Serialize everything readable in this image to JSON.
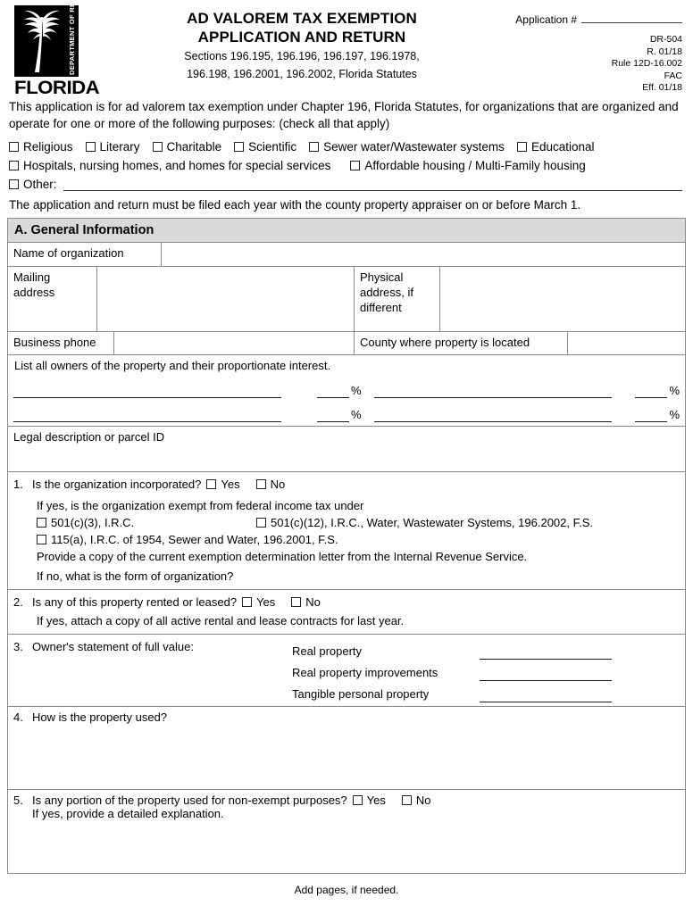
{
  "header": {
    "logo": {
      "vertical_text": "DEPARTMENT OF REVENUE",
      "wordmark": "FLORIDA"
    },
    "title_line1": "AD VALOREM TAX EXEMPTION",
    "title_line2": "APPLICATION AND RETURN",
    "subtitle_line1": "Sections 196.195, 196.196, 196.197, 196.1978,",
    "subtitle_line2": "196.198, 196.2001, 196.2002, Florida Statutes",
    "application_number_label": "Application #",
    "application_number_value": "",
    "form_number": "DR-504",
    "revision": "R. 01/18",
    "rule": "Rule 12D-16.002",
    "fac": "FAC",
    "effective": "Eff. 01/18"
  },
  "intro": {
    "paragraph": "This application is for ad valorem tax exemption under Chapter 196, Florida Statutes, for organizations that are organized and operate for one or more of the following purposes: (check all that apply)",
    "filing_note": "The application and return must be filed each year with the county property appraiser on or before March 1."
  },
  "purposes": {
    "row1": [
      {
        "label": "Religious",
        "checked": false
      },
      {
        "label": "Literary",
        "checked": false
      },
      {
        "label": "Charitable",
        "checked": false
      },
      {
        "label": "Scientific",
        "checked": false
      },
      {
        "label": "Sewer water/Wastewater systems",
        "checked": false
      },
      {
        "label": "Educational",
        "checked": false
      }
    ],
    "row2": [
      {
        "label": "Hospitals, nursing homes, and homes for special services",
        "checked": false
      },
      {
        "label": "Affordable housing / Multi-Family housing",
        "checked": false
      }
    ],
    "row3": {
      "label": "Other:",
      "checked": false,
      "value": ""
    }
  },
  "section_a": {
    "heading": "A. General Information",
    "name_of_organization": {
      "label": "Name of organization",
      "value": ""
    },
    "mailing_address": {
      "label": "Mailing address",
      "value": ""
    },
    "physical_address": {
      "label": "Physical address, if different",
      "value": ""
    },
    "business_phone": {
      "label": "Business phone",
      "value": ""
    },
    "county": {
      "label": "County where property is located",
      "value": ""
    },
    "owners": {
      "instruction": "List all owners of the property and their proportionate interest.",
      "percent_symbol": "%",
      "rows": [
        {
          "owner_left": "",
          "pct_left": "",
          "owner_right": "",
          "pct_right": ""
        },
        {
          "owner_left": "",
          "pct_left": "",
          "owner_right": "",
          "pct_right": ""
        }
      ]
    },
    "legal_description": {
      "label": "Legal description or parcel ID",
      "value": ""
    }
  },
  "questions": {
    "q1": {
      "number": "1.",
      "text": "Is the organization incorporated?",
      "yes_label": "Yes",
      "no_label": "No",
      "sub_intro": "If yes, is the organization exempt from federal income tax under",
      "opt1": "501(c)(3), I.R.C.",
      "opt2": "501(c)(12), I.R.C., Water, Wastewater Systems, 196.2002, F.S.",
      "opt3": "115(a), I.R.C. of 1954, Sewer and Water, 196.2001, F.S.",
      "provide_note": "Provide a copy of the current exemption determination letter from the Internal Revenue Service.",
      "if_no": "If no, what is the form of organization?"
    },
    "q2": {
      "number": "2.",
      "text": "Is any of this property rented or leased?",
      "yes_label": "Yes",
      "no_label": "No",
      "note": "If yes, attach a copy of all active rental and lease contracts for last year."
    },
    "q3": {
      "number": "3.",
      "text": "Owner's statement of full value:",
      "items": [
        {
          "label": "Real property",
          "value": ""
        },
        {
          "label": "Real property improvements",
          "value": ""
        },
        {
          "label": "Tangible personal property",
          "value": ""
        }
      ]
    },
    "q4": {
      "number": "4.",
      "text": "How is the property used?",
      "value": ""
    },
    "q5": {
      "number": "5.",
      "text": "Is any portion of the property used for non-exempt purposes?",
      "yes_label": "Yes",
      "no_label": "No",
      "note": "If yes, provide a detailed explanation.",
      "value": ""
    }
  },
  "footer": {
    "note": "Add pages, if needed."
  }
}
